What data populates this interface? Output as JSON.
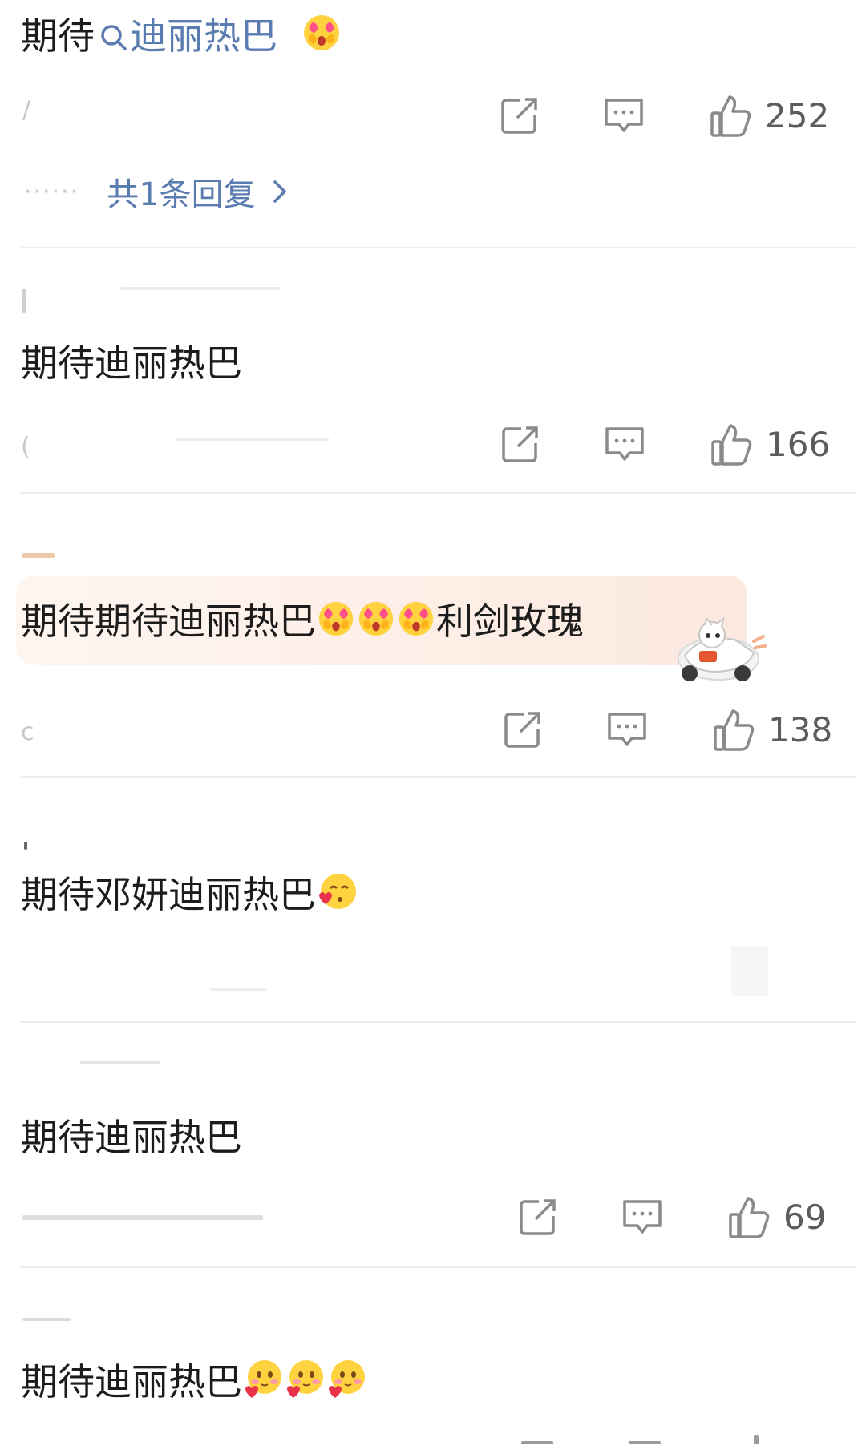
{
  "comments": [
    {
      "text_prefix": "期待",
      "link_text": "迪丽热巴",
      "likes": "252",
      "reply_link": "共1条回复",
      "emoji": [
        "heart-eyes-face-icon"
      ]
    },
    {
      "text": "期待迪丽热巴",
      "likes": "166"
    },
    {
      "text_main": "期待期待迪丽热巴",
      "text_suffix": "利剑玫瑰",
      "likes": "138",
      "emoji": [
        "heart-eyes-face-icon",
        "heart-eyes-face-icon",
        "heart-eyes-face-icon"
      ]
    },
    {
      "text": "期待邓妍迪丽热巴",
      "emoji": [
        "kiss-face-icon"
      ]
    },
    {
      "text": "期待迪丽热巴",
      "likes": "69"
    },
    {
      "text": "期待迪丽热巴",
      "emoji": [
        "shy-face-icon",
        "shy-face-icon",
        "shy-face-icon"
      ]
    }
  ],
  "colors": {
    "link": "#5a7cb0",
    "divider": "#ececec",
    "icon": "#8a8a8a",
    "highlight": "#fdeee6"
  }
}
